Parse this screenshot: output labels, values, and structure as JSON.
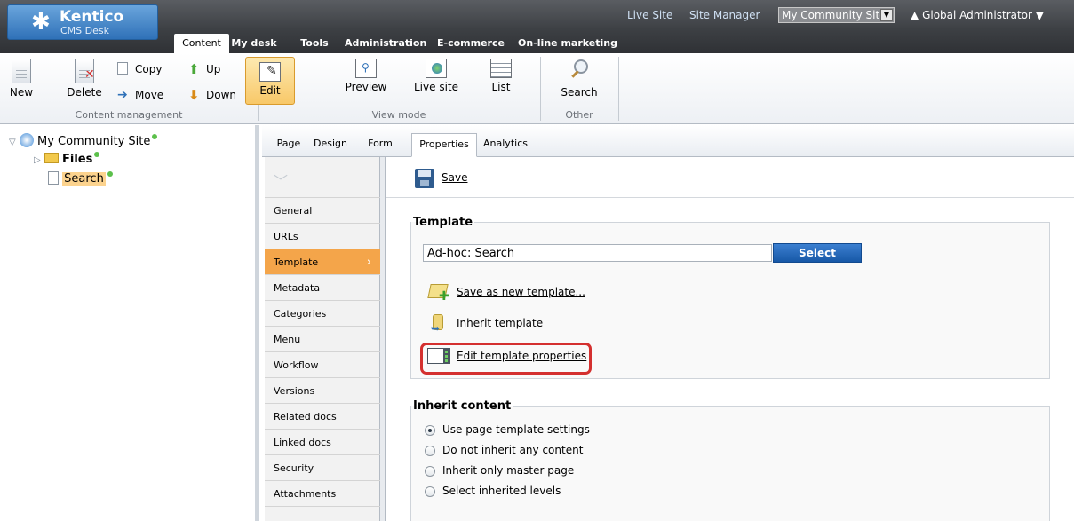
{
  "header": {
    "brand": "Kentico",
    "product": "CMS Desk",
    "links": {
      "live_site": "Live Site",
      "site_manager": "Site Manager"
    },
    "site_selector": "My Community Site",
    "user": "Global Administrator",
    "main_tabs": [
      "Content",
      "My desk",
      "Tools",
      "Administration",
      "E-commerce",
      "On-line marketing"
    ],
    "active_main_tab": "Content"
  },
  "ribbon": {
    "content_management": {
      "label": "Content management",
      "new": "New",
      "delete": "Delete",
      "copy": "Copy",
      "move": "Move",
      "up": "Up",
      "down": "Down"
    },
    "view_mode": {
      "label": "View mode",
      "edit": "Edit",
      "preview": "Preview",
      "live_site": "Live site",
      "list": "List"
    },
    "other": {
      "label": "Other",
      "search": "Search"
    }
  },
  "tree": {
    "root": "My Community Site",
    "files": "Files",
    "search": "Search"
  },
  "page_tabs": [
    "Page",
    "Design",
    "Form",
    "Properties",
    "Analytics"
  ],
  "active_page_tab": "Properties",
  "properties_menu": [
    "General",
    "URLs",
    "Template",
    "Metadata",
    "Categories",
    "Menu",
    "Workflow",
    "Versions",
    "Related docs",
    "Linked docs",
    "Security",
    "Attachments"
  ],
  "active_property": "Template",
  "content": {
    "save": "Save",
    "template": {
      "legend": "Template",
      "value": "Ad-hoc: Search",
      "select_button": "Select",
      "save_as_new": "Save as new template...",
      "inherit": "Inherit template",
      "edit_props": "Edit template properties"
    },
    "inherit_content": {
      "legend": "Inherit content",
      "options": [
        "Use page template settings",
        "Do not inherit any content",
        "Inherit only master page",
        "Select inherited levels"
      ],
      "selected_index": 0
    }
  },
  "colors": {
    "header_dark": "#3d4044",
    "brand_blue": "#2f71b8",
    "active_orange": "#f4a54a",
    "highlight_red": "#d4302f"
  }
}
